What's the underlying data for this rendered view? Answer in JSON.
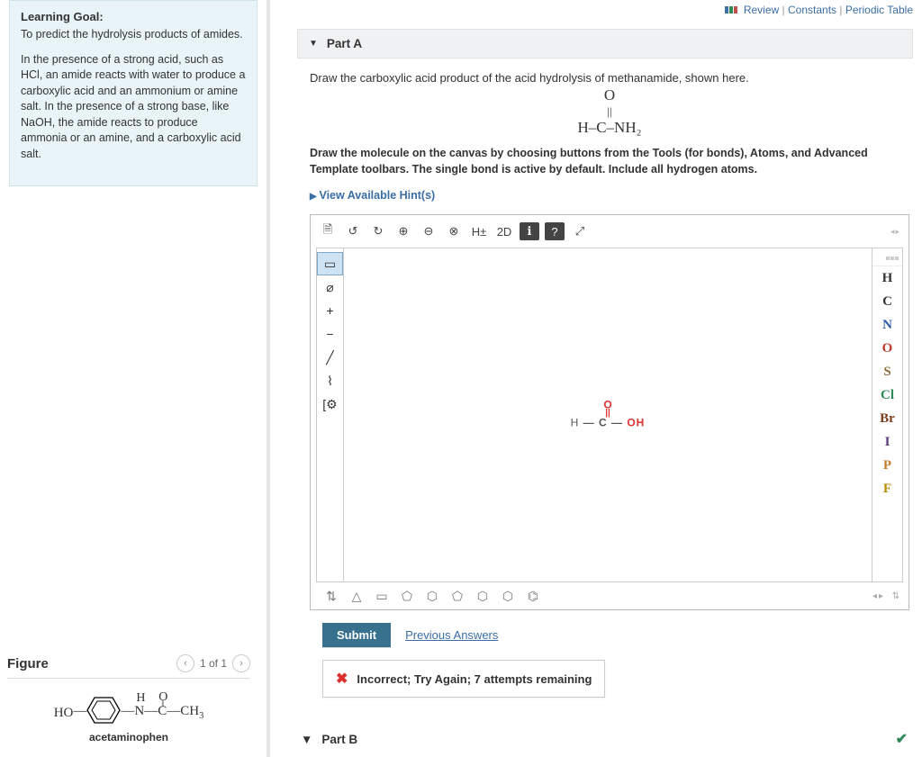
{
  "top_links": {
    "review": "Review",
    "constants": "Constants",
    "periodic": "Periodic Table"
  },
  "learning": {
    "title": "Learning Goal:",
    "goal": "To predict the hydrolysis products of amides.",
    "body": "In the presence of a strong acid, such as HCl, an amide reacts with water to produce a carboxylic acid and an ammonium or amine salt. In the presence of a strong base, like NaOH, the amide reacts to produce ammonia or an amine, and a carboxylic acid salt."
  },
  "figure": {
    "heading": "Figure",
    "pager": "1 of 1",
    "molecule_name": "acetaminophen"
  },
  "partA": {
    "title": "Part A",
    "question": "Draw the carboxylic acid product of the acid hydrolysis of methanamide, shown here.",
    "formula_line1": "O",
    "formula_line2": "||",
    "formula_line3": "H–C–NH₂",
    "instructions": "Draw the molecule on the canvas by choosing buttons from the Tools (for bonds), Atoms, and Advanced Template toolbars. The single bond is active by default. Include all hydrogen atoms.",
    "hints": "View Available Hint(s)"
  },
  "editor": {
    "left_tools": [
      "▭",
      "⌀",
      "+",
      "−",
      "╱",
      "⌇",
      "[⚙"
    ],
    "top_tools": [
      "🗎",
      "↺",
      "↻",
      "⊕",
      "⊖",
      "⊗",
      "H±",
      "2D",
      "ℹ",
      "?",
      "⤢"
    ],
    "atoms": [
      {
        "sym": "H",
        "color": "#333"
      },
      {
        "sym": "C",
        "color": "#333"
      },
      {
        "sym": "N",
        "color": "#2e5aa8"
      },
      {
        "sym": "O",
        "color": "#c0392b"
      },
      {
        "sym": "S",
        "color": "#8a6d3b"
      },
      {
        "sym": "Cl",
        "color": "#2e8b57"
      },
      {
        "sym": "Br",
        "color": "#7a3b1a"
      },
      {
        "sym": "I",
        "color": "#5a3a78"
      },
      {
        "sym": "P",
        "color": "#c77d2e"
      },
      {
        "sym": "F",
        "color": "#b88a00"
      }
    ],
    "bottom_tools": [
      "⇅",
      "△",
      "▭",
      "⬠",
      "⬡",
      "⬠",
      "⬡",
      "⬡",
      "⌬"
    ],
    "drawn": {
      "top": "O",
      "bond": "||",
      "row": "H — C — OH"
    }
  },
  "actions": {
    "submit": "Submit",
    "previous": "Previous Answers",
    "feedback": "Incorrect; Try Again; 7 attempts remaining"
  },
  "partB": {
    "title": "Part B"
  }
}
